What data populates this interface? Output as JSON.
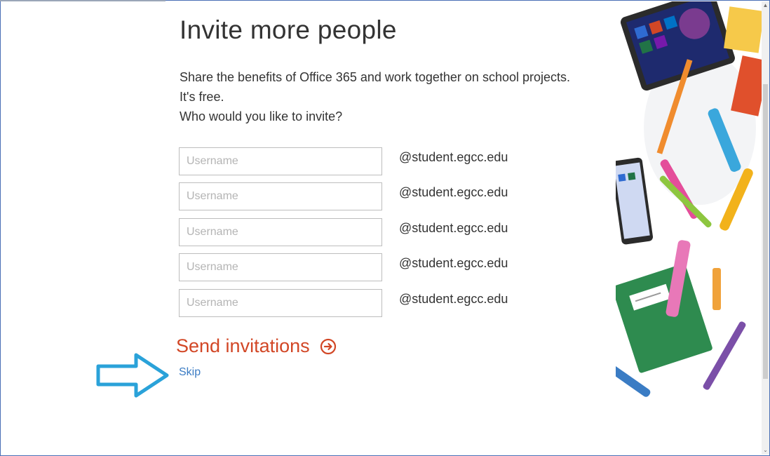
{
  "page": {
    "title": "Invite more people",
    "description_line1": "Share the benefits of Office 365 and work together on school projects. It's free.",
    "description_line2": "Who would you like to invite?"
  },
  "invites": [
    {
      "placeholder": "Username",
      "domain": "@student.egcc.edu"
    },
    {
      "placeholder": "Username",
      "domain": "@student.egcc.edu"
    },
    {
      "placeholder": "Username",
      "domain": "@student.egcc.edu"
    },
    {
      "placeholder": "Username",
      "domain": "@student.egcc.edu"
    },
    {
      "placeholder": "Username",
      "domain": "@student.egcc.edu"
    }
  ],
  "actions": {
    "send_label": "Send invitations",
    "send_icon": "arrow-circle-right-icon",
    "skip_label": "Skip"
  },
  "colors": {
    "accent": "#d24726",
    "link": "#3b7cc4",
    "callout_arrow": "#2aa2d9",
    "frame_border": "#4a6fb5"
  }
}
